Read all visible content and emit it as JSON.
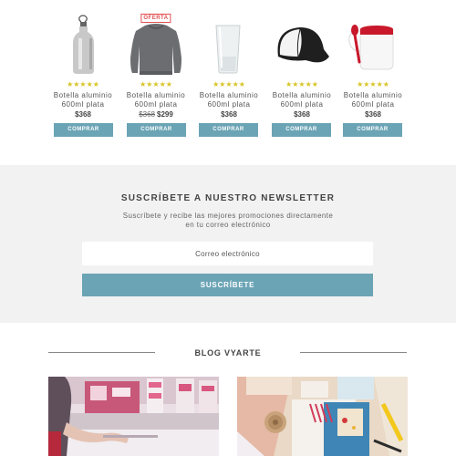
{
  "products": [
    {
      "name": "Botella aluminio 600ml plata",
      "line1": "Botella aluminio",
      "line2": "600ml plata",
      "price": "$368",
      "old_price": "",
      "badge": "",
      "stars": "★★★★★",
      "button": "COMPRAR",
      "icon": "aluminum-bottle-icon"
    },
    {
      "name": "Botella aluminio 600ml plata",
      "line1": "Botella aluminio",
      "line2": "600ml plata",
      "price": "$299",
      "old_price": "$368",
      "badge": "OFERTA",
      "stars": "★★★★★",
      "button": "COMPRAR",
      "icon": "sweatshirt-icon"
    },
    {
      "name": "Botella aluminio 600ml plata",
      "line1": "Botella aluminio",
      "line2": "600ml plata",
      "price": "$368",
      "old_price": "",
      "badge": "",
      "stars": "★★★★★",
      "button": "COMPRAR",
      "icon": "shot-glass-icon"
    },
    {
      "name": "Botella aluminio 600ml plata",
      "line1": "Botella aluminio",
      "line2": "600ml plata",
      "price": "$368",
      "old_price": "",
      "badge": "",
      "stars": "★★★★★",
      "button": "COMPRAR",
      "icon": "cap-icon"
    },
    {
      "name": "Botella aluminio 600ml plata",
      "line1": "Botella aluminio",
      "line2": "600ml plata",
      "price": "$368",
      "old_price": "",
      "badge": "",
      "stars": "★★★★★",
      "button": "COMPRAR",
      "icon": "mug-icon"
    }
  ],
  "newsletter": {
    "title": "SUSCRÍBETE A NUESTRO NEWSLETTER",
    "subtitle_line1": "Suscríbete y recibe las mejores promociones directamente",
    "subtitle_line2": "en tu correo electrónico",
    "email_placeholder": "Correo electrónico",
    "email_value": "",
    "button": "SUSCRÍBETE"
  },
  "blog": {
    "title": "BLOG VYARTE",
    "cards": [
      {
        "icon": "printing-workshop-photo"
      },
      {
        "icon": "craft-supplies-photo"
      }
    ]
  },
  "colors": {
    "accent": "#6ba4b5",
    "star": "#d7c425",
    "badge": "#e05050",
    "newsletter_bg": "#f2f2f2"
  }
}
